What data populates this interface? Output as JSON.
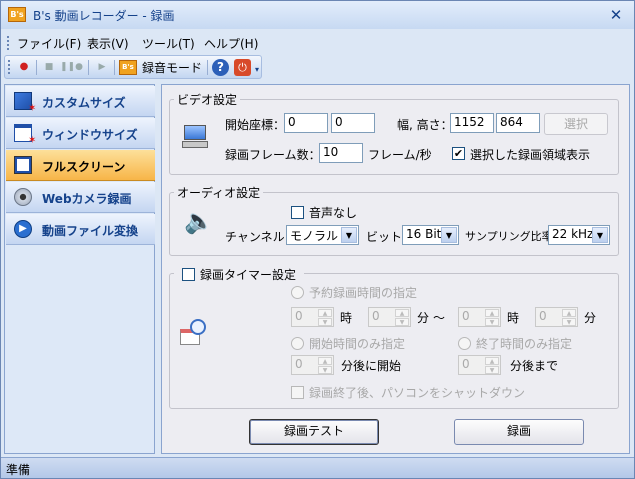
{
  "window": {
    "title": "B's 動画レコーダー - 録画",
    "icon_text": "B's"
  },
  "menu": [
    "ファイル(F)",
    "表示(V)",
    "ツール(T)",
    "ヘルプ(H)"
  ],
  "toolbar": {
    "rec_mode_label": "録音モード"
  },
  "sidebar": {
    "items": [
      {
        "label": "カスタムサイズ"
      },
      {
        "label": "ウィンドウサイズ"
      },
      {
        "label": "フルスクリーン"
      },
      {
        "label": "Webカメラ録画"
      },
      {
        "label": "動画ファイル変換"
      }
    ],
    "active_index": 2
  },
  "video": {
    "title": "ビデオ設定",
    "start_label": "開始座標：",
    "start_x": "0",
    "start_y": "0",
    "size_label": "幅, 高さ：",
    "width": "1152",
    "height": "864",
    "select_button": "選択",
    "fps_label": "録画フレーム数：",
    "fps_value": "10",
    "fps_unit": "フレーム/秒",
    "show_region_label": "選択した録画領域表示",
    "show_region_checked": true
  },
  "audio": {
    "title": "オーディオ設定",
    "mute_label": "音声なし",
    "mute_checked": false,
    "channel_label": "チャンネル：",
    "channel_value": "モノラル",
    "bit_label": "ビット：",
    "bit_value": "16 Bit",
    "rate_label": "サンプリング比率：",
    "rate_value": "22 kHz"
  },
  "timer": {
    "title": "録画タイマー設定",
    "enabled": false,
    "reserve_label": "予約録画時間の指定",
    "spin_values": [
      "0",
      "0",
      "0",
      "0"
    ],
    "hour_label": "時",
    "minute_label": "分",
    "tilde": "～",
    "start_only_label": "開始時間のみ指定",
    "end_only_label": "終了時間のみ指定",
    "start_after_value": "0",
    "start_after_label": "分後に開始",
    "end_after_value": "0",
    "end_after_label": "分後まで",
    "shutdown_label": "録画終了後、パソコンをシャットダウン"
  },
  "buttons": {
    "test": "録画テスト",
    "record": "録画"
  },
  "status": {
    "text": "準備"
  }
}
